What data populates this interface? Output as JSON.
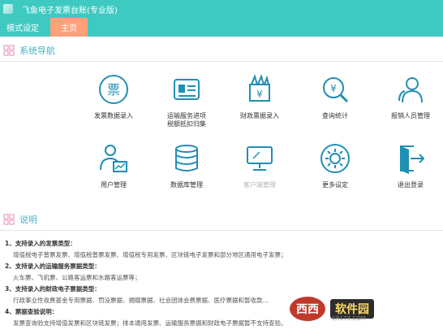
{
  "app": {
    "title": "飞鱼电子发票台账(专业版)"
  },
  "tabs": {
    "mode": "模式设定",
    "home": "主页"
  },
  "nav": {
    "heading": "系统导航",
    "items": [
      {
        "label": "发票数据录入",
        "icon": "invoice-ticket-icon"
      },
      {
        "label": "运输服务进项\n税额抵扣归集",
        "icon": "id-card-icon"
      },
      {
        "label": "财政票据录入",
        "icon": "fiscal-bill-icon"
      },
      {
        "label": "查询统计",
        "icon": "search-yen-icon"
      },
      {
        "label": "报销人员管理",
        "icon": "users-icon"
      },
      {
        "label": "用户管理",
        "icon": "user-chart-icon"
      },
      {
        "label": "数据库管理",
        "icon": "database-icon"
      },
      {
        "label": "客户端管理",
        "icon": "monitor-icon"
      },
      {
        "label": "更多设定",
        "icon": "gear-icon"
      },
      {
        "label": "退出登录",
        "icon": "logout-icon"
      }
    ]
  },
  "description": {
    "heading": "说明",
    "lines": [
      {
        "type": "h",
        "text": "1、支持录入的发票类型："
      },
      {
        "type": "b",
        "text": "增值税电子普票发票、增值税普票发票、增值税专用发票、区块链电子发票和部分地区通用电子发票；"
      },
      {
        "type": "h",
        "text": "2、支持录入的运输服务票据类型："
      },
      {
        "type": "b",
        "text": "火车票、飞机票、公路客运票和水路客运票等；"
      },
      {
        "type": "h",
        "text": "3、支持录入的财政电子票据类型："
      },
      {
        "type": "b",
        "text": "行政事业性收费基金专用票据、罚没票据、捐赠票据、社会团体会费票据、医疗票据和暂收款…"
      },
      {
        "type": "h",
        "text": "4、票据查验说明："
      },
      {
        "type": "b",
        "text": "发票查询验支持增值发票和区块链发票；排本通用发票、运输服务票据和财政电子票据暂不支持查验。"
      }
    ]
  },
  "watermark": {
    "logo": "西西",
    "name": "软件园",
    "url": "CR173.COM"
  },
  "colors": {
    "accent": "#3ec9c1",
    "icon": "#1f8fb4",
    "tab_active": "#ffa07a",
    "heading": "#45b3c6"
  }
}
